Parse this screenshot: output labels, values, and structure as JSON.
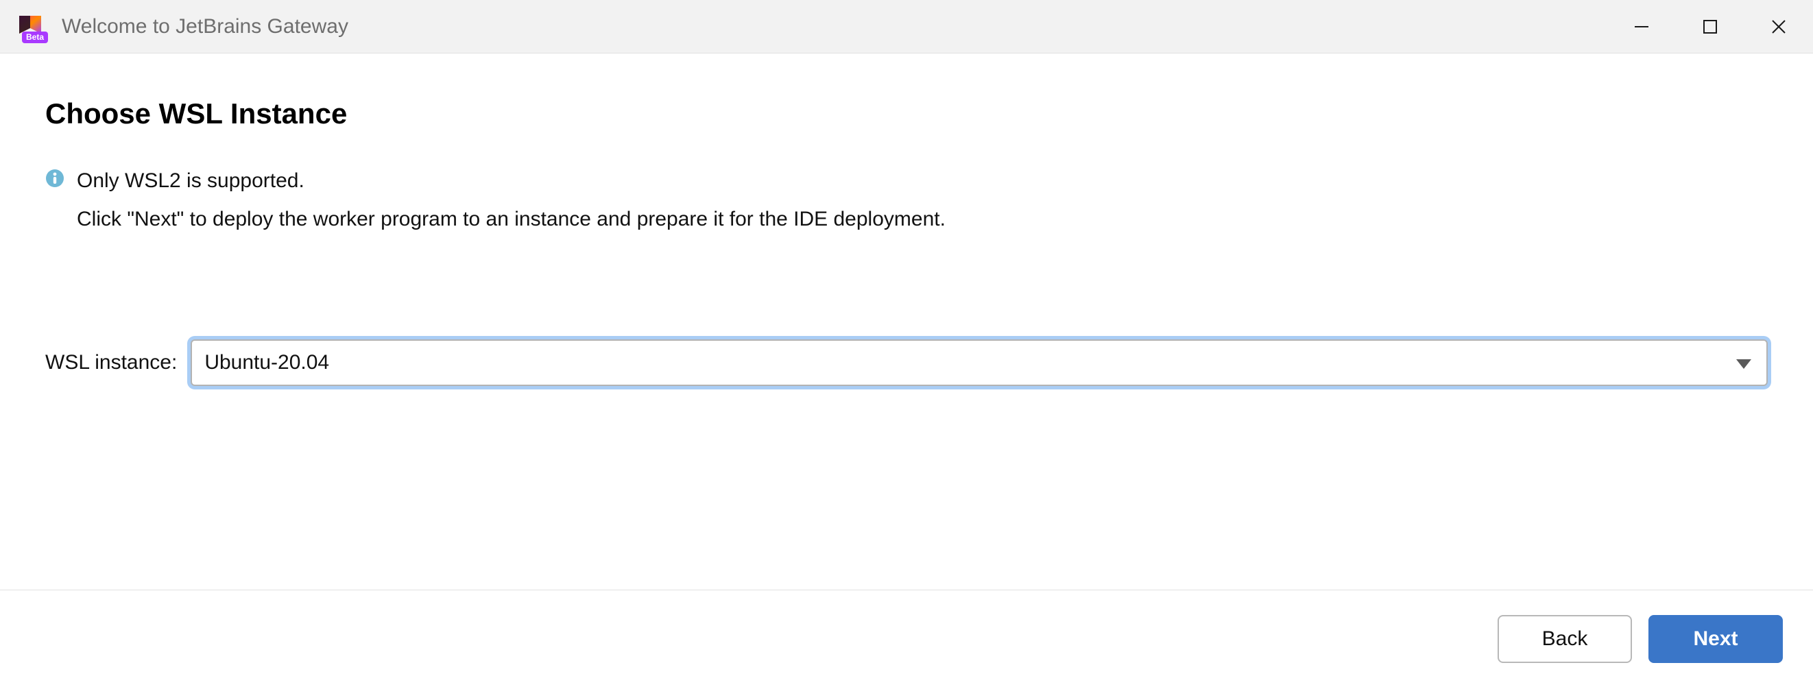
{
  "window": {
    "title": "Welcome to JetBrains Gateway",
    "beta_label": "Beta"
  },
  "page": {
    "heading": "Choose WSL Instance",
    "info_line1": "Only WSL2 is supported.",
    "info_line2": "Click \"Next\" to deploy the worker program to an instance and prepare it for the IDE deployment."
  },
  "form": {
    "wsl_label": "WSL instance:",
    "wsl_selected": "Ubuntu-20.04"
  },
  "footer": {
    "back_label": "Back",
    "next_label": "Next"
  }
}
